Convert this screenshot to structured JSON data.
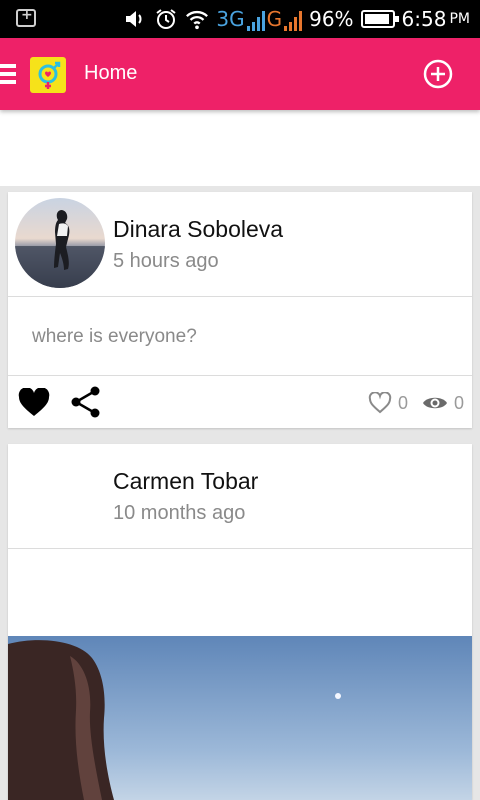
{
  "status_bar": {
    "icons": [
      "notification-icon",
      "volume-icon",
      "alarm-icon",
      "wifi-icon"
    ],
    "network_3g": "3G",
    "network_g": "G",
    "battery": "96%",
    "time": "6:58",
    "ampm": "PM"
  },
  "app_bar": {
    "title": "Home",
    "menu_icon": "menu-icon",
    "logo_icon": "gender-symbol-logo-icon",
    "add_icon": "add-circle-icon",
    "color": "#ee2168"
  },
  "feed": {
    "posts": [
      {
        "author": "Dinara Soboleva",
        "time_ago": "5 hours ago",
        "text": "where is everyone?",
        "likes": "0",
        "views": "0",
        "has_avatar": true
      },
      {
        "author": "Carmen Tobar",
        "time_ago": "10 months ago",
        "has_photo": true
      }
    ]
  }
}
